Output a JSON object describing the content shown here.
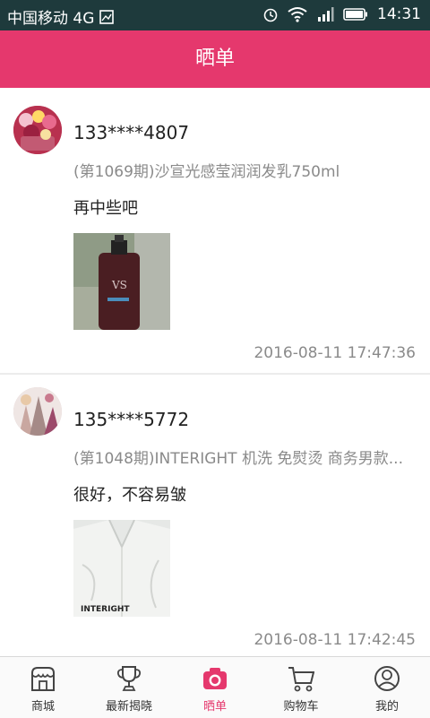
{
  "status_bar": {
    "carrier": "中国移动 4G",
    "time": "14:31"
  },
  "header": {
    "title": "晒单"
  },
  "posts": [
    {
      "user": "133****4807",
      "product": "(第1069期)沙宣光感莹润润发乳750ml",
      "comment": "再中些吧",
      "time": "2016-08-11 17:47:36"
    },
    {
      "user": "135****5772",
      "product": "(第1048期)INTERIGHT 机洗 免熨烫 商务男款...",
      "comment": "很好，不容易皱",
      "time": "2016-08-11 17:42:45"
    }
  ],
  "tabs": [
    {
      "label": "商城",
      "icon": "store-icon"
    },
    {
      "label": "最新揭晓",
      "icon": "trophy-icon"
    },
    {
      "label": "晒单",
      "icon": "camera-icon",
      "active": true
    },
    {
      "label": "购物车",
      "icon": "cart-icon"
    },
    {
      "label": "我的",
      "icon": "user-icon"
    }
  ],
  "colors": {
    "accent": "#e5386d",
    "status_bar": "#1e3a3c"
  }
}
